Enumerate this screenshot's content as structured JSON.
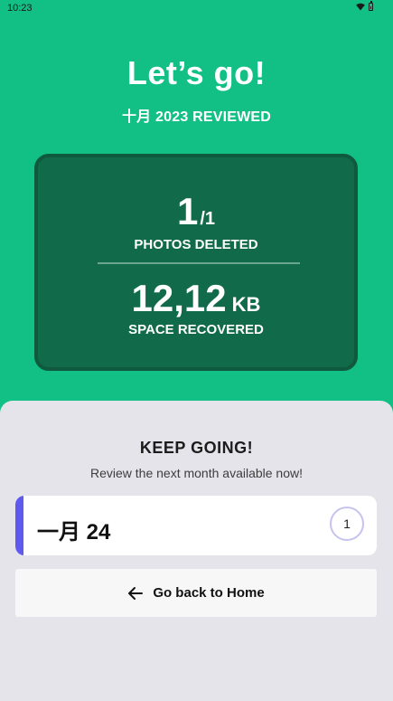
{
  "status_bar": {
    "time": "10:23",
    "wifi_icon": "wifi-icon",
    "battery_icon": "battery-icon"
  },
  "hero": {
    "title": "Let’s go!",
    "subtitle": "十月 2023 REVIEWED"
  },
  "stats": {
    "photos_deleted_value": "1",
    "photos_deleted_total": "/1",
    "photos_deleted_label": "PHOTOS DELETED",
    "space_value": "12,12",
    "space_unit": "KB",
    "space_label": "SPACE RECOVERED"
  },
  "next_section": {
    "heading": "KEEP GOING!",
    "subtext": "Review the next month available now!",
    "month_card": {
      "label": "一月 24",
      "count": "1",
      "accent_color": "#5f59f0"
    },
    "home_button": {
      "label": "Go back to Home",
      "icon": "arrow-left-icon"
    }
  },
  "colors": {
    "background": "#12bf84",
    "card": "#116b4b",
    "sheet": "#e5e4ea"
  }
}
